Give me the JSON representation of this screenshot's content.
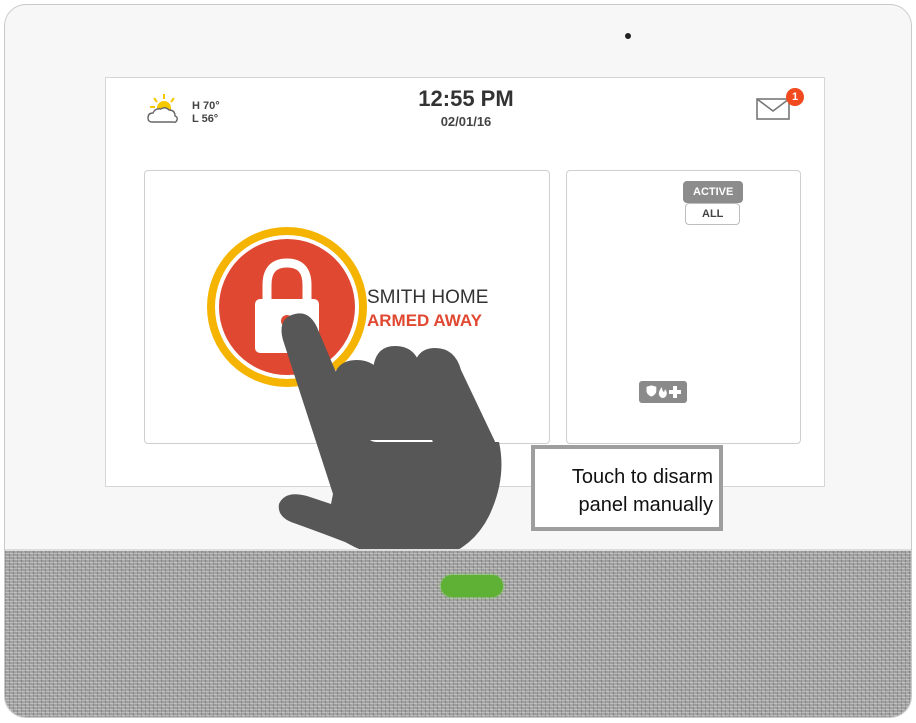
{
  "header": {
    "weather": {
      "icon": "partly-cloudy-icon",
      "high": "H 70°",
      "low": "L 56°"
    },
    "time": "12:55 PM",
    "date": "02/01/16",
    "messages": {
      "icon": "envelope-icon",
      "count": "1"
    }
  },
  "security": {
    "home_name": "SMITH HOME",
    "state": "ARMED AWAY",
    "icon": "padlock-icon",
    "accent": "#e04832",
    "ring": "#f5b400"
  },
  "sensors": {
    "tabs": [
      {
        "label": "ACTIVE",
        "selected": true
      },
      {
        "label": "ALL",
        "selected": false
      }
    ]
  },
  "emergency": {
    "icons": [
      "shield-icon",
      "fire-icon",
      "medical-cross-icon"
    ]
  },
  "callout": {
    "line1": "Touch to disarm",
    "line2": "panel manually"
  },
  "status_led": {
    "color": "#5fb135"
  }
}
